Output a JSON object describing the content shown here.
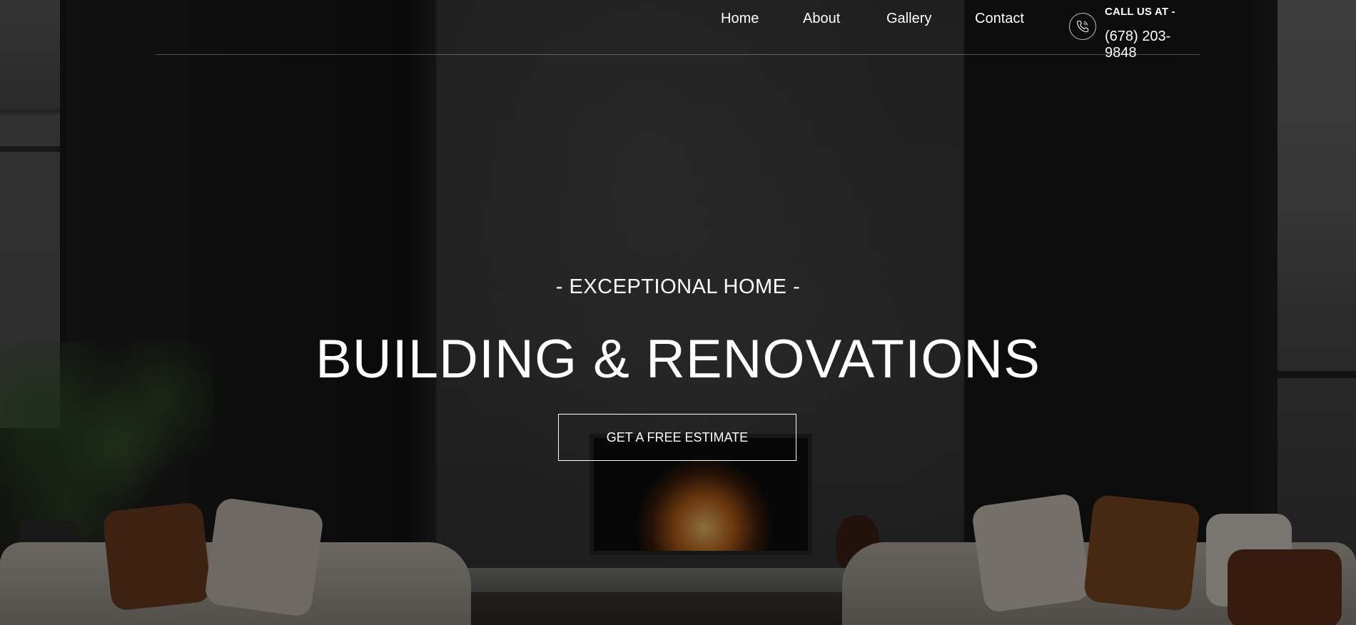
{
  "nav": {
    "home": "Home",
    "about": "About",
    "gallery": "Gallery",
    "contact": "Contact"
  },
  "contact": {
    "icon": "phone-icon",
    "label": "CALL US AT -",
    "number": "(678) 203-9848"
  },
  "hero": {
    "kicker": "- EXCEPTIONAL HOME -",
    "headline": "BUILDING & RENOVATIONS",
    "cta": "GET A FREE ESTIMATE"
  },
  "colors": {
    "text": "#ffffff",
    "overlay": "#000000"
  }
}
